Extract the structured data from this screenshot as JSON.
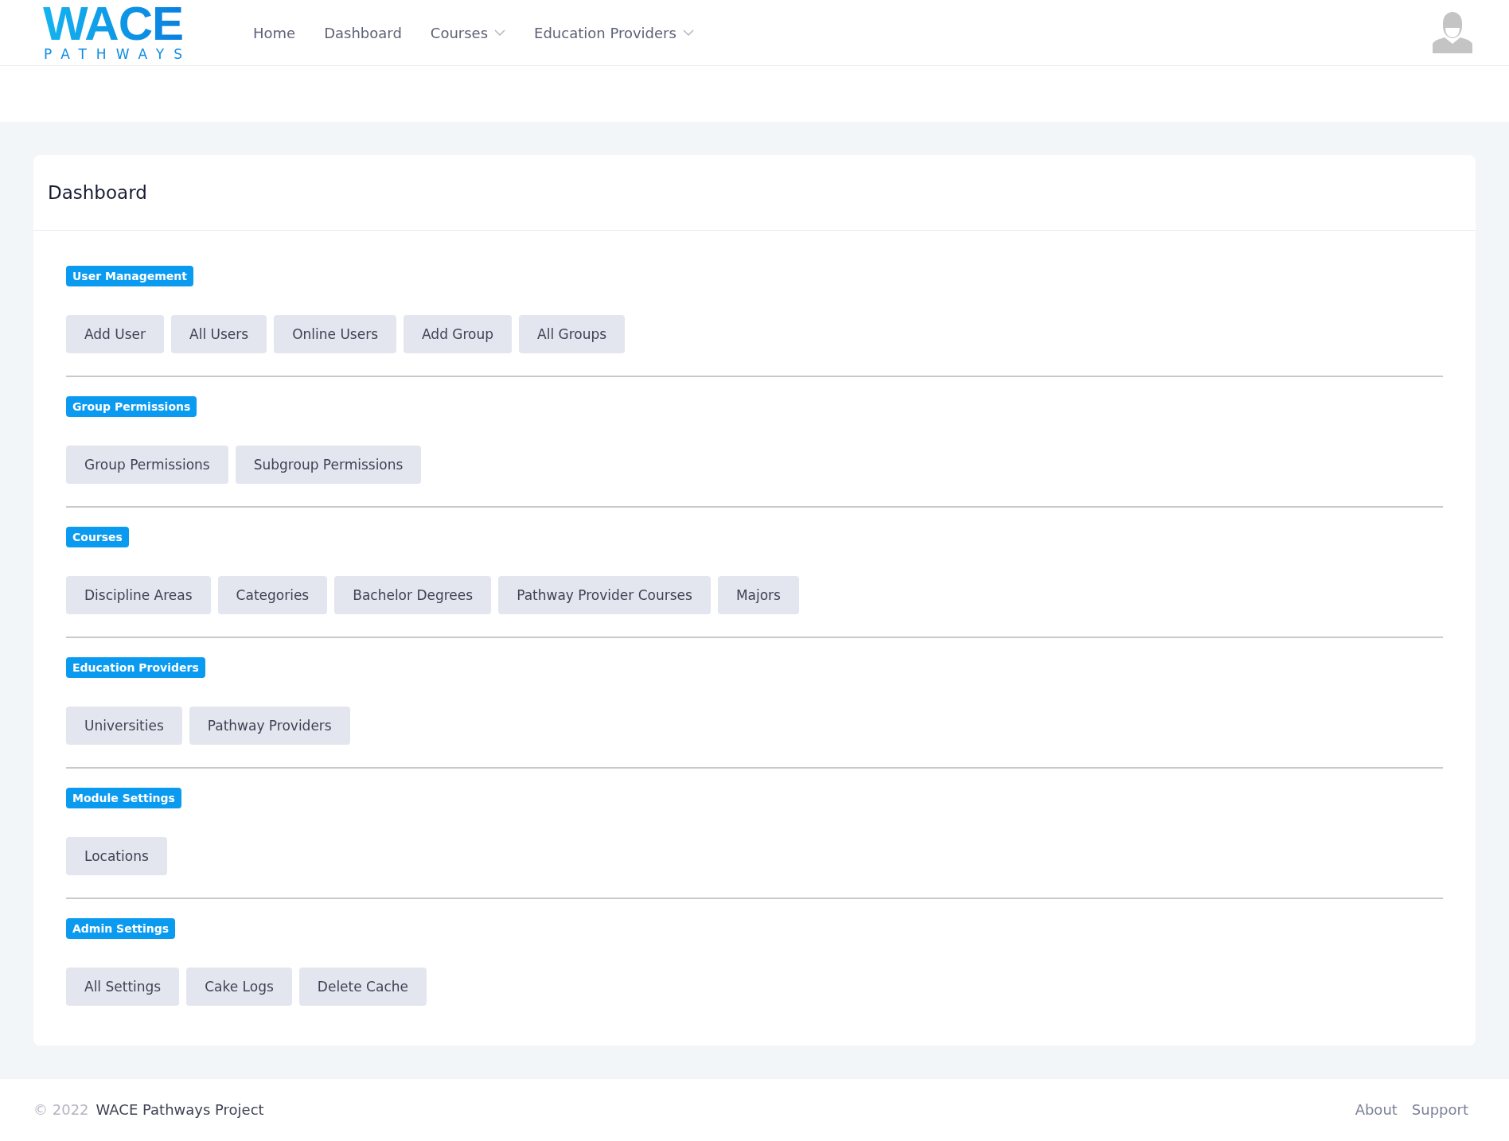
{
  "logo": {
    "title": "WACE",
    "subtitle": "PATHWAYS"
  },
  "nav": [
    {
      "label": "Home",
      "dropdown": false
    },
    {
      "label": "Dashboard",
      "dropdown": false
    },
    {
      "label": "Courses",
      "dropdown": true
    },
    {
      "label": "Education Providers",
      "dropdown": true
    }
  ],
  "card": {
    "title": "Dashboard",
    "sections": [
      {
        "label": "User Management",
        "buttons": [
          "Add User",
          "All Users",
          "Online Users",
          "Add Group",
          "All Groups"
        ]
      },
      {
        "label": "Group Permissions",
        "buttons": [
          "Group Permissions",
          "Subgroup Permissions"
        ]
      },
      {
        "label": "Courses",
        "buttons": [
          "Discipline Areas",
          "Categories",
          "Bachelor Degrees",
          "Pathway Provider Courses",
          "Majors"
        ]
      },
      {
        "label": "Education Providers",
        "buttons": [
          "Universities",
          "Pathway Providers"
        ]
      },
      {
        "label": "Module Settings",
        "buttons": [
          "Locations"
        ]
      },
      {
        "label": "Admin Settings",
        "buttons": [
          "All Settings",
          "Cake Logs",
          "Delete Cache"
        ]
      }
    ]
  },
  "footer": {
    "copyright": "© 2022",
    "project": "WACE Pathways Project",
    "links": [
      "About",
      "Support"
    ]
  }
}
